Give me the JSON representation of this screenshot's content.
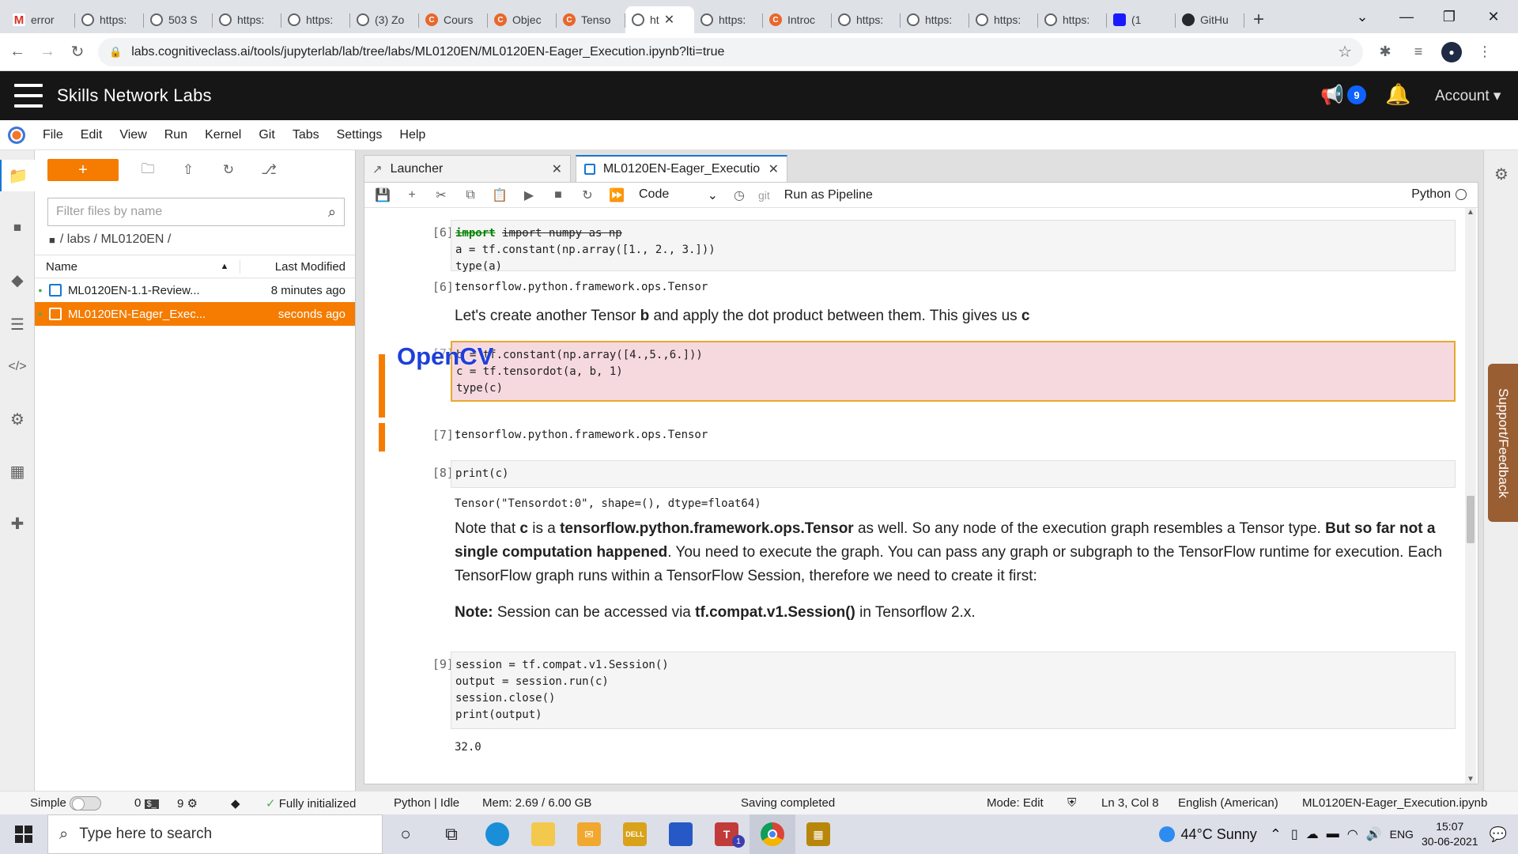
{
  "browser": {
    "tabs": [
      {
        "label": "error",
        "icon": "gmail-icon"
      },
      {
        "label": "https:",
        "icon": "globe-icon"
      },
      {
        "label": "503 S",
        "icon": "globe-icon"
      },
      {
        "label": "https:",
        "icon": "globe-icon"
      },
      {
        "label": "https:",
        "icon": "globe-icon"
      },
      {
        "label": "(3) Zo",
        "icon": "globe-icon"
      },
      {
        "label": "Cours",
        "icon": "cognitive-class-icon"
      },
      {
        "label": "Objec",
        "icon": "cognitive-class-icon"
      },
      {
        "label": "Tenso",
        "icon": "cognitive-class-icon"
      },
      {
        "label": "ht",
        "icon": "globe-icon"
      },
      {
        "label": "https:",
        "icon": "globe-icon"
      },
      {
        "label": "Introc",
        "icon": "cognitive-class-icon"
      },
      {
        "label": "https:",
        "icon": "globe-icon"
      },
      {
        "label": "https:",
        "icon": "globe-icon"
      },
      {
        "label": "https:",
        "icon": "globe-icon"
      },
      {
        "label": "https:",
        "icon": "globe-icon"
      },
      {
        "label": "(1",
        "icon": "youtube-icon"
      },
      {
        "label": "GitHu",
        "icon": "github-icon"
      }
    ],
    "url": "labs.cognitiveclass.ai/tools/jupyterlab/lab/tree/labs/ML0120EN/ML0120EN-Eager_Execution.ipynb?lti=true"
  },
  "header": {
    "brand": "Skills Network Labs",
    "notification_count": "9",
    "account_label": "Account"
  },
  "menubar": [
    "File",
    "Edit",
    "View",
    "Run",
    "Kernel",
    "Git",
    "Tabs",
    "Settings",
    "Help"
  ],
  "filebrowser": {
    "new_label": "+",
    "filter_placeholder": "Filter files by name",
    "breadcrumb": "/ labs / ML0120EN /",
    "col_name": "Name",
    "col_modified": "Last Modified",
    "files": [
      {
        "name": "ML0120EN-1.1-Review...",
        "modified": "8 minutes ago",
        "selected": false
      },
      {
        "name": "ML0120EN-Eager_Exec...",
        "modified": "seconds ago",
        "selected": true
      }
    ]
  },
  "doc_tabs": [
    {
      "label": "Launcher",
      "icon": "launcher-icon"
    },
    {
      "label": "ML0120EN-Eager_Executio",
      "icon": "notebook-icon"
    }
  ],
  "toolbar": {
    "cell_type": "Code",
    "git_label": "git",
    "pipeline_label": "Run as Pipeline",
    "kernel": "Python"
  },
  "cells": {
    "c6_in_prompt": "[6]:",
    "c6_out_prompt": "[6]:",
    "c6_output": "tensorflow.python.framework.ops.Tensor",
    "md1_pre": "Let's create another Tensor ",
    "md1_b": "b",
    "md1_mid": " and apply the dot product between them. This gives us ",
    "md1_c": "c",
    "c7_in_prompt": "[7]:",
    "opencv_overlay": "OpenCV",
    "c7_out_prompt": "[7]:",
    "c7_output": "tensorflow.python.framework.ops.Tensor",
    "c8_in_prompt": "[8]:",
    "c8_output": "Tensor(\"Tensordot:0\", shape=(), dtype=float64)",
    "md2_p1": "Note that ",
    "md2_b1": "c",
    "md2_p2": " is a ",
    "md2_b2": "tensorflow.python.framework.ops.Tensor",
    "md2_p3": " as well. So any node of the execution graph resembles a Tensor type. ",
    "md2_b3": "But so far not a single computation happened",
    "md2_p4": ". You need to execute the graph. You can pass any graph or subgraph to the TensorFlow runtime for execution. Each TensorFlow graph runs within a TensorFlow Session, therefore we need to create it first:",
    "md3_b1": "Note:",
    "md3_p1": " Session can be accessed via ",
    "md3_b2": "tf.compat.v1.Session()",
    "md3_p2": " in Tensorflow 2.x.",
    "c9_in_prompt": "[9]:",
    "c9_output": "32.0"
  },
  "code": {
    "c6": [
      "import numpy as np",
      "a = tf.constant(np.array([1., 2., 3.]))",
      "type(a)"
    ],
    "c7": [
      "b = tf.constant(np.array([4.,5.,6.]))",
      "c = tf.tensordot(a, b, 1)",
      "type(c)"
    ],
    "c8": [
      "print(c)"
    ],
    "c9": [
      "session = tf.compat.v1.Session()",
      "output = session.run(c)",
      "session.close()",
      "print(output)"
    ]
  },
  "support_label": "Support/Feedback",
  "statusbar": {
    "mode_simple": "Simple",
    "count_a": "0",
    "count_b": "9",
    "init_status": "Fully initialized",
    "kernel_status": "Python | Idle",
    "mem": "Mem: 2.69 / 6.00 GB",
    "save_status": "Saving completed",
    "edit_mode": "Mode: Edit",
    "cursor": "Ln 3, Col 8",
    "language": "English (American)",
    "filename": "ML0120EN-Eager_Execution.ipynb"
  },
  "taskbar": {
    "search_placeholder": "Type here to search",
    "teams_badge": "1",
    "weather": "44°C  Sunny",
    "lang": "ENG",
    "time": "15:07",
    "date": "30-06-2021"
  },
  "colors": {
    "accent": "#f57c00",
    "brand_bg": "#161616",
    "link": "#1976d2"
  }
}
